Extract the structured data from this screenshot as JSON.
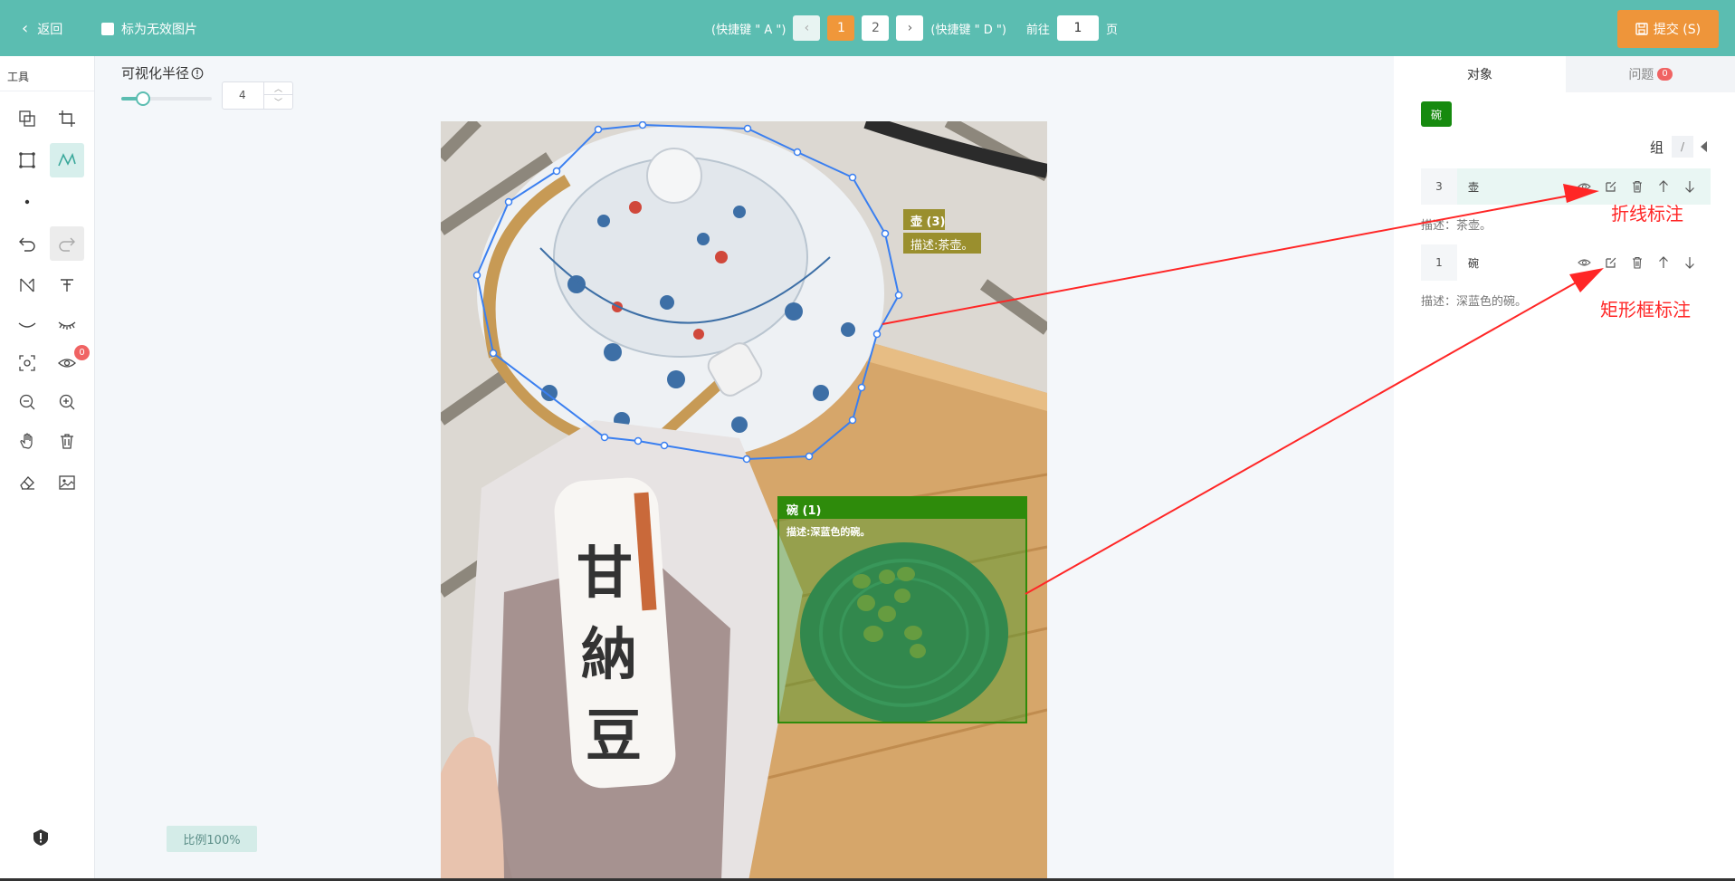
{
  "topbar": {
    "back_label": "返回",
    "invalid_label": "标为无效图片",
    "shortcut_prev": "(快捷键 \" A \")",
    "shortcut_next": "(快捷键 \" D \")",
    "pages": [
      "1",
      "2"
    ],
    "active_page": "1",
    "goto_prefix": "前往",
    "goto_value": "1",
    "goto_suffix": "页",
    "submit_label": "提交 (S)"
  },
  "tools": {
    "title": "工具",
    "hidden_count": "0"
  },
  "radius": {
    "label": "可视化半径",
    "value": "4",
    "level_fraction": 0.25
  },
  "scale_label": "比例100%",
  "annotations": {
    "polygon_tag": "壶 (3)",
    "polygon_desc": "描述:茶壶。",
    "rect_tag": "碗 (1)",
    "rect_desc": "描述:深蓝色的碗。"
  },
  "panel": {
    "tab_objects": "对象",
    "tab_issues": "问题",
    "issue_count": "0",
    "chip": "碗",
    "group_label": "组",
    "group_sep": "/",
    "objects": [
      {
        "id": "3",
        "name": "壶",
        "desc": "描述：茶壶。"
      },
      {
        "id": "1",
        "name": "碗",
        "desc": "描述：深蓝色的碗。"
      }
    ]
  },
  "callouts": {
    "polyline": "折线标注",
    "rect": "矩形框标注"
  },
  "colors": {
    "primary": "#5bbdb1",
    "submit": "#ee953a",
    "active_page": "#f0973a",
    "polygon": "#3a7ff0",
    "rect": "#2e8b0b",
    "tag_olive": "#9a8f2e",
    "callout": "#ff2626"
  }
}
